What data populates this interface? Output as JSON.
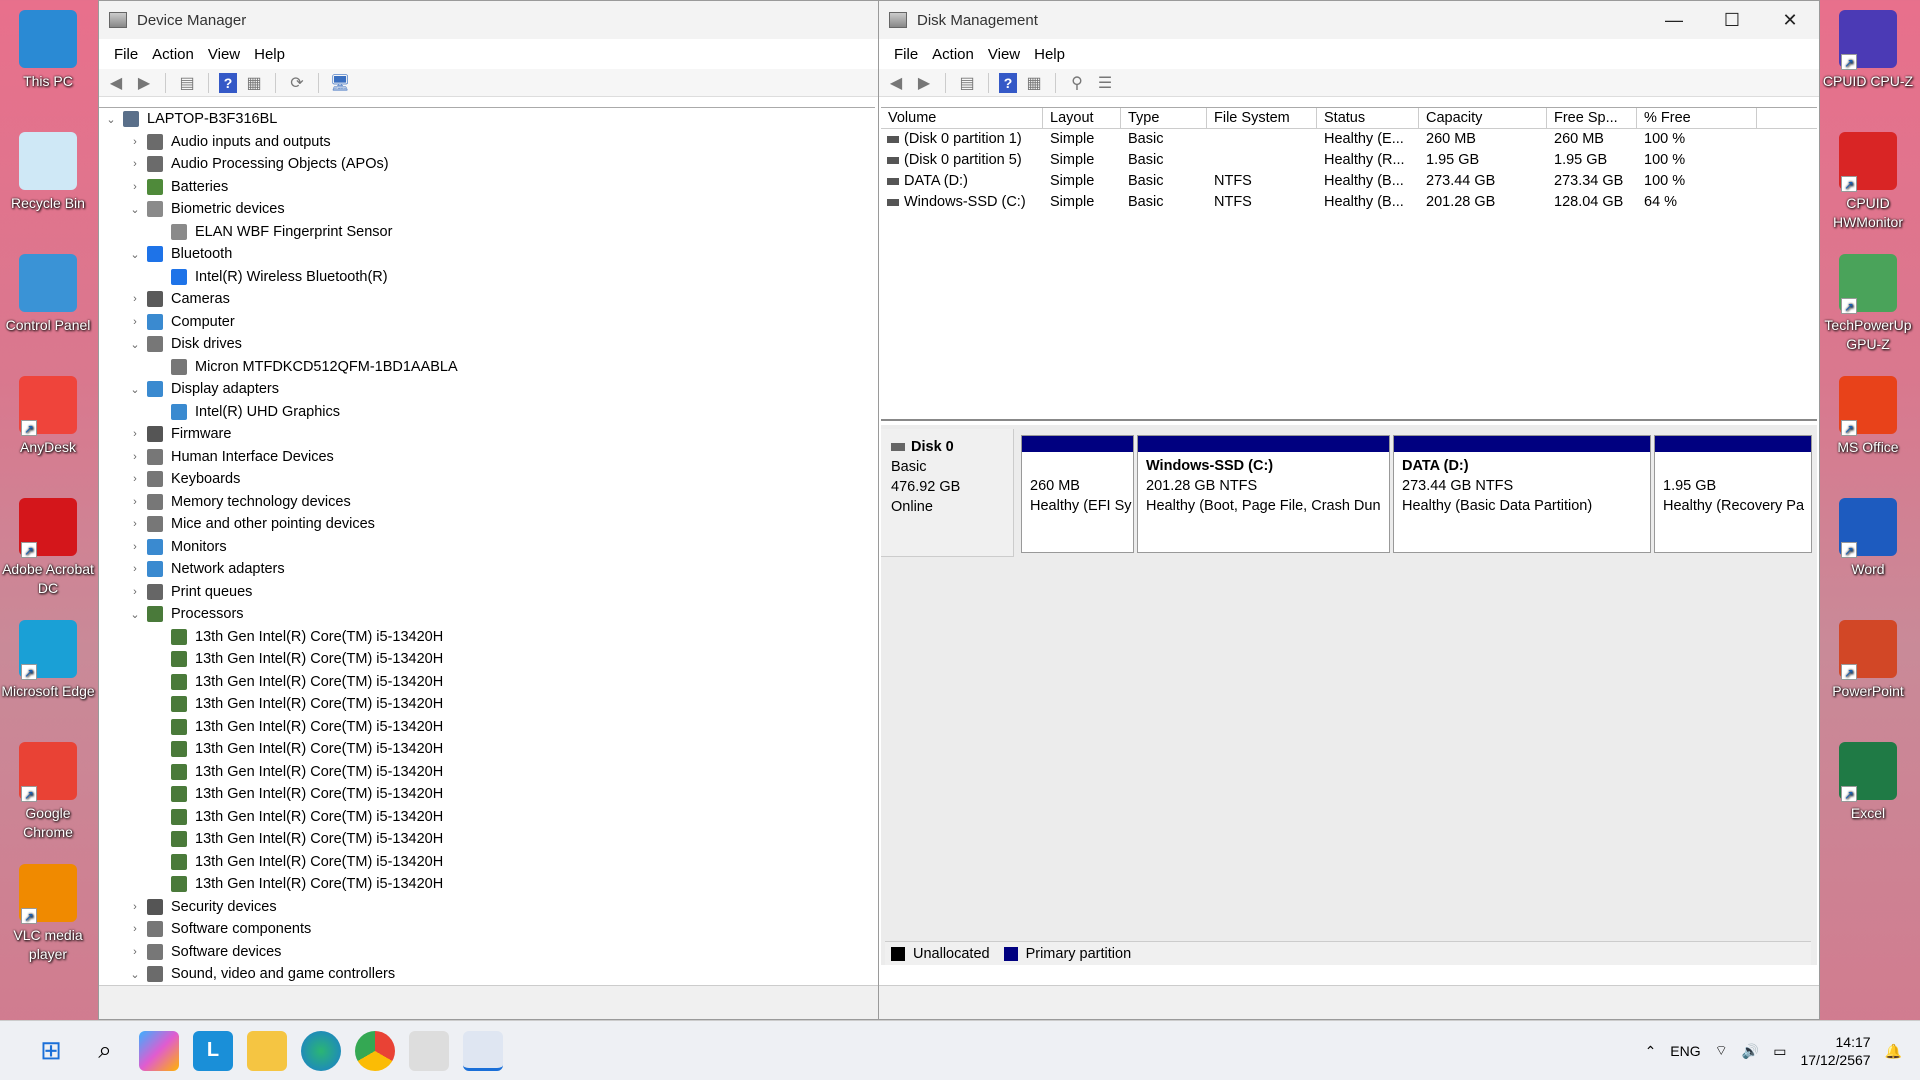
{
  "desktop_left": [
    {
      "label": "This PC",
      "icon": "monitor-icon",
      "color": "#2a8ad4"
    },
    {
      "label": "Recycle Bin",
      "icon": "recycle-bin-icon",
      "color": "#cfe8f6"
    },
    {
      "label": "Control Panel",
      "icon": "control-panel-icon",
      "color": "#3a93d6"
    },
    {
      "label": "AnyDesk",
      "icon": "anydesk-icon",
      "color": "#ef443b"
    },
    {
      "label": "Adobe Acrobat DC",
      "icon": "acrobat-icon",
      "color": "#d4161b"
    },
    {
      "label": "Microsoft Edge",
      "icon": "edge-icon",
      "color": "#1aa0d6"
    },
    {
      "label": "Google Chrome",
      "icon": "chrome-icon",
      "color": "#e94235"
    },
    {
      "label": "VLC media player",
      "icon": "vlc-icon",
      "color": "#f08a00"
    }
  ],
  "desktop_right": [
    {
      "label": "CPUID CPU-Z",
      "icon": "cpuz-icon",
      "color": "#4b3ab5"
    },
    {
      "label": "CPUID HWMonitor",
      "icon": "hwmonitor-icon",
      "color": "#d92525"
    },
    {
      "label": "TechPowerUp GPU-Z",
      "icon": "gpuz-icon",
      "color": "#4aa35a"
    },
    {
      "label": "MS Office",
      "icon": "office-icon",
      "color": "#e8421a"
    },
    {
      "label": "Word",
      "icon": "word-icon",
      "color": "#1d5bbf"
    },
    {
      "label": "PowerPoint",
      "icon": "powerpoint-icon",
      "color": "#d24726"
    },
    {
      "label": "Excel",
      "icon": "excel-icon",
      "color": "#1f7a45"
    }
  ],
  "device_manager": {
    "title": "Device Manager",
    "menu": [
      "File",
      "Action",
      "View",
      "Help"
    ],
    "tree": [
      {
        "label": "LAPTOP-B3F316BL",
        "level": 0,
        "state": "open",
        "icon": "computer-icon",
        "color": "#5a6f8a"
      },
      {
        "label": "Audio inputs and outputs",
        "level": 1,
        "state": "closed",
        "icon": "speaker-icon",
        "color": "#6b6b6b"
      },
      {
        "label": "Audio Processing Objects (APOs)",
        "level": 1,
        "state": "closed",
        "icon": "speaker-icon",
        "color": "#6b6b6b"
      },
      {
        "label": "Batteries",
        "level": 1,
        "state": "closed",
        "icon": "battery-icon",
        "color": "#4f8a3a"
      },
      {
        "label": "Biometric devices",
        "level": 1,
        "state": "open",
        "icon": "fingerprint-icon",
        "color": "#8a8a8a"
      },
      {
        "label": "ELAN WBF Fingerprint Sensor",
        "level": 2,
        "state": "leaf",
        "icon": "fingerprint-icon",
        "color": "#8a8a8a"
      },
      {
        "label": "Bluetooth",
        "level": 1,
        "state": "open",
        "icon": "bluetooth-icon",
        "color": "#1e73e8"
      },
      {
        "label": "Intel(R) Wireless Bluetooth(R)",
        "level": 2,
        "state": "leaf",
        "icon": "bluetooth-icon",
        "color": "#1e73e8"
      },
      {
        "label": "Cameras",
        "level": 1,
        "state": "closed",
        "icon": "camera-icon",
        "color": "#5a5a5a"
      },
      {
        "label": "Computer",
        "level": 1,
        "state": "closed",
        "icon": "monitor-icon",
        "color": "#3a8ad0"
      },
      {
        "label": "Disk drives",
        "level": 1,
        "state": "open",
        "icon": "disk-drive-icon",
        "color": "#777"
      },
      {
        "label": "Micron MTFDKCD512QFM-1BD1AABLA",
        "level": 2,
        "state": "leaf",
        "icon": "disk-drive-icon",
        "color": "#777"
      },
      {
        "label": "Display adapters",
        "level": 1,
        "state": "open",
        "icon": "display-adapter-icon",
        "color": "#3a8ad0"
      },
      {
        "label": "Intel(R) UHD Graphics",
        "level": 2,
        "state": "leaf",
        "icon": "display-adapter-icon",
        "color": "#3a8ad0"
      },
      {
        "label": "Firmware",
        "level": 1,
        "state": "closed",
        "icon": "firmware-icon",
        "color": "#555"
      },
      {
        "label": "Human Interface Devices",
        "level": 1,
        "state": "closed",
        "icon": "hid-icon",
        "color": "#777"
      },
      {
        "label": "Keyboards",
        "level": 1,
        "state": "closed",
        "icon": "keyboard-icon",
        "color": "#777"
      },
      {
        "label": "Memory technology devices",
        "level": 1,
        "state": "closed",
        "icon": "memory-icon",
        "color": "#777"
      },
      {
        "label": "Mice and other pointing devices",
        "level": 1,
        "state": "closed",
        "icon": "mouse-icon",
        "color": "#777"
      },
      {
        "label": "Monitors",
        "level": 1,
        "state": "closed",
        "icon": "monitor-icon",
        "color": "#3a8ad0"
      },
      {
        "label": "Network adapters",
        "level": 1,
        "state": "closed",
        "icon": "network-icon",
        "color": "#3a8ad0"
      },
      {
        "label": "Print queues",
        "level": 1,
        "state": "closed",
        "icon": "printer-icon",
        "color": "#666"
      },
      {
        "label": "Processors",
        "level": 1,
        "state": "open",
        "icon": "processor-icon",
        "color": "#4a7a3a"
      },
      {
        "label": "13th Gen Intel(R) Core(TM) i5-13420H",
        "level": 2,
        "state": "leaf",
        "icon": "processor-icon",
        "color": "#4a7a3a"
      },
      {
        "label": "13th Gen Intel(R) Core(TM) i5-13420H",
        "level": 2,
        "state": "leaf",
        "icon": "processor-icon",
        "color": "#4a7a3a"
      },
      {
        "label": "13th Gen Intel(R) Core(TM) i5-13420H",
        "level": 2,
        "state": "leaf",
        "icon": "processor-icon",
        "color": "#4a7a3a"
      },
      {
        "label": "13th Gen Intel(R) Core(TM) i5-13420H",
        "level": 2,
        "state": "leaf",
        "icon": "processor-icon",
        "color": "#4a7a3a"
      },
      {
        "label": "13th Gen Intel(R) Core(TM) i5-13420H",
        "level": 2,
        "state": "leaf",
        "icon": "processor-icon",
        "color": "#4a7a3a"
      },
      {
        "label": "13th Gen Intel(R) Core(TM) i5-13420H",
        "level": 2,
        "state": "leaf",
        "icon": "processor-icon",
        "color": "#4a7a3a"
      },
      {
        "label": "13th Gen Intel(R) Core(TM) i5-13420H",
        "level": 2,
        "state": "leaf",
        "icon": "processor-icon",
        "color": "#4a7a3a"
      },
      {
        "label": "13th Gen Intel(R) Core(TM) i5-13420H",
        "level": 2,
        "state": "leaf",
        "icon": "processor-icon",
        "color": "#4a7a3a"
      },
      {
        "label": "13th Gen Intel(R) Core(TM) i5-13420H",
        "level": 2,
        "state": "leaf",
        "icon": "processor-icon",
        "color": "#4a7a3a"
      },
      {
        "label": "13th Gen Intel(R) Core(TM) i5-13420H",
        "level": 2,
        "state": "leaf",
        "icon": "processor-icon",
        "color": "#4a7a3a"
      },
      {
        "label": "13th Gen Intel(R) Core(TM) i5-13420H",
        "level": 2,
        "state": "leaf",
        "icon": "processor-icon",
        "color": "#4a7a3a"
      },
      {
        "label": "13th Gen Intel(R) Core(TM) i5-13420H",
        "level": 2,
        "state": "leaf",
        "icon": "processor-icon",
        "color": "#4a7a3a"
      },
      {
        "label": "Security devices",
        "level": 1,
        "state": "closed",
        "icon": "security-icon",
        "color": "#555"
      },
      {
        "label": "Software components",
        "level": 1,
        "state": "closed",
        "icon": "software-icon",
        "color": "#777"
      },
      {
        "label": "Software devices",
        "level": 1,
        "state": "closed",
        "icon": "software-icon",
        "color": "#777"
      },
      {
        "label": "Sound, video and game controllers",
        "level": 1,
        "state": "open",
        "icon": "speaker-icon",
        "color": "#6b6b6b"
      }
    ]
  },
  "disk_management": {
    "title": "Disk Management",
    "menu": [
      "File",
      "Action",
      "View",
      "Help"
    ],
    "columns": [
      "Volume",
      "Layout",
      "Type",
      "File System",
      "Status",
      "Capacity",
      "Free Sp...",
      "% Free"
    ],
    "volumes": [
      [
        "(Disk 0 partition 1)",
        "Simple",
        "Basic",
        "",
        "Healthy (E...",
        "260 MB",
        "260 MB",
        "100 %"
      ],
      [
        "(Disk 0 partition 5)",
        "Simple",
        "Basic",
        "",
        "Healthy (R...",
        "1.95 GB",
        "1.95 GB",
        "100 %"
      ],
      [
        "DATA (D:)",
        "Simple",
        "Basic",
        "NTFS",
        "Healthy (B...",
        "273.44 GB",
        "273.34 GB",
        "100 %"
      ],
      [
        "Windows-SSD (C:)",
        "Simple",
        "Basic",
        "NTFS",
        "Healthy (B...",
        "201.28 GB",
        "128.04 GB",
        "64 %"
      ]
    ],
    "disk": {
      "name": "Disk 0",
      "type": "Basic",
      "size": "476.92 GB",
      "status": "Online"
    },
    "partitions": [
      {
        "name": "",
        "size": "260 MB",
        "status": "Healthy (EFI Sy"
      },
      {
        "name": "Windows-SSD  (C:)",
        "size": "201.28 GB NTFS",
        "status": "Healthy (Boot, Page File, Crash Dun"
      },
      {
        "name": "DATA  (D:)",
        "size": "273.44 GB NTFS",
        "status": "Healthy (Basic Data Partition)"
      },
      {
        "name": "",
        "size": "1.95 GB",
        "status": "Healthy (Recovery Pa"
      }
    ],
    "legend": [
      {
        "label": "Unallocated",
        "color": "#000000"
      },
      {
        "label": "Primary partition",
        "color": "#000080"
      }
    ]
  },
  "taskbar": {
    "language": "ENG",
    "time": "14:17",
    "date": "17/12/2567"
  }
}
